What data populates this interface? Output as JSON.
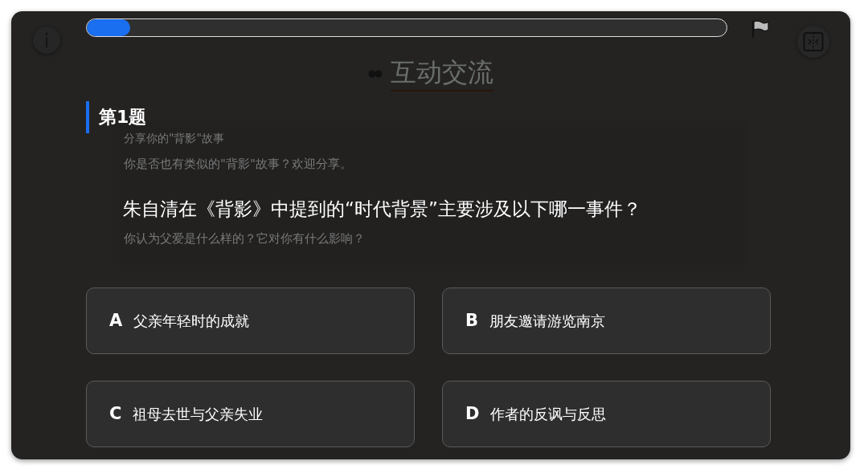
{
  "progress": {
    "level": 0.068
  },
  "background_panel": {
    "title": "互动交流",
    "items": [
      {
        "heading": "分享你的\"背影\"故事",
        "text": "你是否也有类似的\"背影\"故事？欢迎分享。"
      },
      {
        "text": "你认为父爱是什么样的？它对你有什么影响？"
      }
    ]
  },
  "question": {
    "number_label": "第1题",
    "text": "朱自清在《背影》中提到的“时代背景”主要涉及以下哪一事件？",
    "options": [
      {
        "letter": "A",
        "text": "父亲年轻时的成就",
        "selected": false
      },
      {
        "letter": "B",
        "text": "朋友邀请游览南京",
        "selected": false
      },
      {
        "letter": "C",
        "text": "祖母去世与父亲失业",
        "selected": false
      },
      {
        "letter": "D",
        "text": "作者的反讽与反思",
        "selected": false
      }
    ]
  }
}
